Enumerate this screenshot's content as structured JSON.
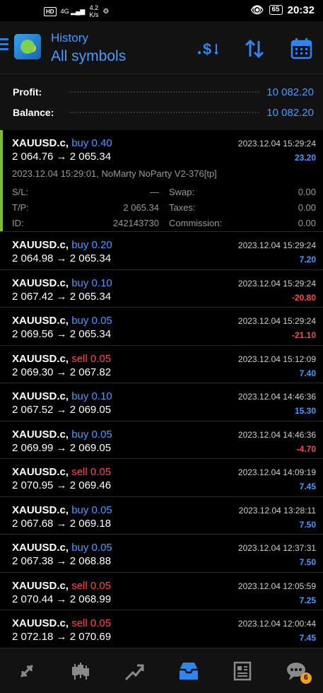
{
  "status_bar": {
    "hd": "HD",
    "network": "4G",
    "speed_value": "4.2",
    "speed_unit": "K/s",
    "battery": "65",
    "time": "20:32"
  },
  "header": {
    "title": "History",
    "subtitle": "All symbols"
  },
  "summary": {
    "profit_label": "Profit:",
    "profit_value": "10 082.20",
    "balance_label": "Balance:",
    "balance_value": "10 082.20"
  },
  "deals": [
    {
      "symbol": "XAUUSD.c,",
      "type": "buy 0.40",
      "prices": "2 064.76 → 2 065.34",
      "time": "2023.12.04 15:29:24",
      "profit": "23.20"
    },
    {
      "symbol": "XAUUSD.c,",
      "type": "buy 0.20",
      "prices": "2 064.98 → 2 065.34",
      "time": "2023.12.04 15:29:24",
      "profit": "7.20"
    },
    {
      "symbol": "XAUUSD.c,",
      "type": "buy 0.10",
      "prices": "2 067.42 → 2 065.34",
      "time": "2023.12.04 15:29:24",
      "profit": "-20.80"
    },
    {
      "symbol": "XAUUSD.c,",
      "type": "buy 0.05",
      "prices": "2 069.56 → 2 065.34",
      "time": "2023.12.04 15:29:24",
      "profit": "-21.10"
    },
    {
      "symbol": "XAUUSD.c,",
      "type": "sell 0.05",
      "prices": "2 069.30 → 2 067.82",
      "time": "2023.12.04 15:12:09",
      "profit": "7.40"
    },
    {
      "symbol": "XAUUSD.c,",
      "type": "buy 0.10",
      "prices": "2 067.52 → 2 069.05",
      "time": "2023.12.04 14:46:36",
      "profit": "15.30"
    },
    {
      "symbol": "XAUUSD.c,",
      "type": "buy 0.05",
      "prices": "2 069.99 → 2 069.05",
      "time": "2023.12.04 14:46:36",
      "profit": "-4.70"
    },
    {
      "symbol": "XAUUSD.c,",
      "type": "sell 0.05",
      "prices": "2 070.95 → 2 069.46",
      "time": "2023.12.04 14:09:19",
      "profit": "7.45"
    },
    {
      "symbol": "XAUUSD.c,",
      "type": "buy 0.05",
      "prices": "2 067.68 → 2 069.18",
      "time": "2023.12.04 13:28:11",
      "profit": "7.50"
    },
    {
      "symbol": "XAUUSD.c,",
      "type": "buy 0.05",
      "prices": "2 067.38 → 2 068.88",
      "time": "2023.12.04 12:37:31",
      "profit": "7.50"
    },
    {
      "symbol": "XAUUSD.c,",
      "type": "sell 0.05",
      "prices": "2 070.44 → 2 068.99",
      "time": "2023.12.04 12:05:59",
      "profit": "7.25"
    },
    {
      "symbol": "XAUUSD.c,",
      "type": "sell 0.05",
      "prices": "2 072.18 → 2 070.69",
      "time": "2023.12.04 12:00:44",
      "profit": "7.45"
    }
  ],
  "expanded": {
    "comment": "2023.12.04 15:29:01, NoMarty NoParty V2-376[tp]",
    "sl_label": "S/L:",
    "sl_value": "—",
    "swap_label": "Swap:",
    "swap_value": "0.00",
    "tp_label": "T/P:",
    "tp_value": "2 065.34",
    "taxes_label": "Taxes:",
    "taxes_value": "0.00",
    "id_label": "ID:",
    "id_value": "242143730",
    "commission_label": "Commission:",
    "commission_value": "0.00"
  },
  "bottom_nav": {
    "chat_badge": "6"
  },
  "colors": {
    "accent": "#4a9bff",
    "sell": "#ff4a4a",
    "selected_bar": "#7bbf2e",
    "badge": "#f0a020"
  }
}
